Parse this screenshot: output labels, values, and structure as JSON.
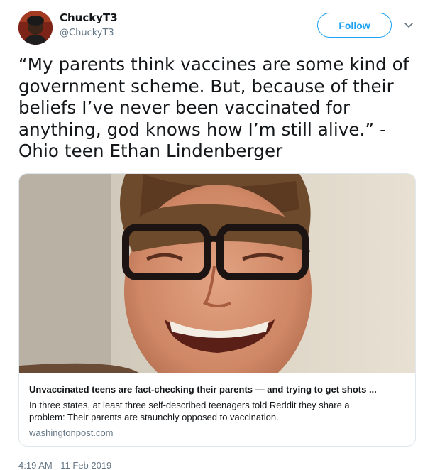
{
  "user": {
    "display_name": "ChuckyT3",
    "handle": "@ChuckyT3",
    "avatar_icon": "user-avatar"
  },
  "follow_button": {
    "label": "Follow"
  },
  "caret_icon": "chevron-down-icon",
  "tweet": {
    "text": "“My parents think vaccines are some kind of government scheme. But, because of their beliefs I’ve never been vaccinated for anything, god knows how I’m still alive.” - Ohio teen Ethan Lindenberger",
    "timestamp": "4:19 AM - 11 Feb 2019"
  },
  "card": {
    "title": "Unvaccinated teens are fact-checking their parents — and trying to get shots ...",
    "description": "In three states, at least three self-described teenagers told Reddit they share a problem: Their parents are staunchly opposed to vaccination.",
    "domain": "washingtonpost.com"
  },
  "colors": {
    "accent": "#1da1f2",
    "text_primary": "#14171a",
    "text_secondary": "#657786",
    "border": "#e1e8ed"
  }
}
